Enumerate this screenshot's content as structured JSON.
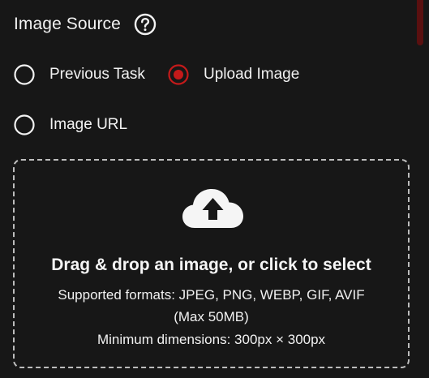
{
  "header": {
    "title": "Image Source",
    "help_icon": "question-circle-icon"
  },
  "source_options": [
    {
      "label": "Previous Task",
      "selected": false
    },
    {
      "label": "Upload Image",
      "selected": true
    },
    {
      "label": "Image URL",
      "selected": false
    }
  ],
  "dropzone": {
    "icon": "cloud-upload-icon",
    "title": "Drag & drop an image, or click to select",
    "formats_line1": "Supported formats: JPEG, PNG, WEBP, GIF, AVIF",
    "formats_line2": "(Max 50MB)",
    "dimensions": "Minimum dimensions: 300px × 300px"
  },
  "colors": {
    "background": "#171717",
    "text": "#f2f2f2",
    "accent": "#c41a1a",
    "border": "#bdbdbd"
  }
}
